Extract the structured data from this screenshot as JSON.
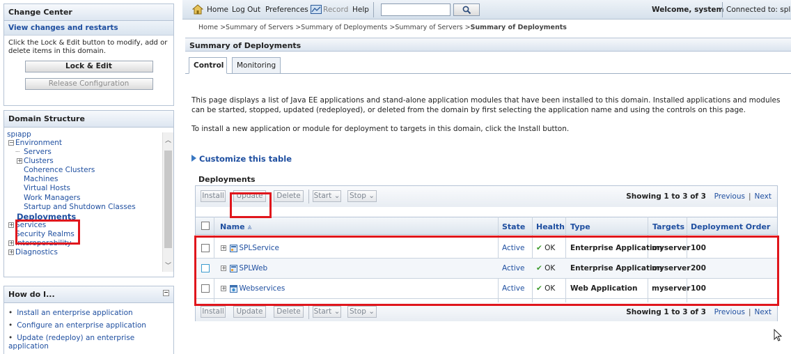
{
  "change_center": {
    "title": "Change Center",
    "view_changes": "View changes and restarts",
    "hint": "Click the Lock & Edit button to modify, add or delete items in this domain.",
    "lock_edit": "Lock & Edit",
    "release_config": "Release Configuration"
  },
  "domain_structure": {
    "title": "Domain Structure",
    "root": "splapp",
    "nodes": [
      "Environment",
      "Servers",
      "Clusters",
      "Coherence Clusters",
      "Machines",
      "Virtual Hosts",
      "Work Managers",
      "Startup and Shutdown Classes",
      "Deployments",
      "Services",
      "Security Realms",
      "Interoperability",
      "Diagnostics"
    ]
  },
  "how_do_i": {
    "title": "How do I...",
    "items": [
      "Install an enterprise application",
      "Configure an enterprise application",
      "Update (redeploy) an enterprise application"
    ]
  },
  "toolbar": {
    "home": "Home",
    "logout": "Log Out",
    "preferences": "Preferences",
    "record": "Record",
    "help": "Help",
    "search_value": "",
    "welcome_label": "Welcome, system",
    "connected_label": "Connected to: splap"
  },
  "breadcrumb": {
    "path": "Home >Summary of Servers >Summary of Deployments >Summary of Servers >",
    "current": "Summary of Deployments"
  },
  "page": {
    "title": "Summary of Deployments",
    "tabs": [
      "Control",
      "Monitoring"
    ],
    "desc1": "This page displays a list of Java EE applications and stand-alone application modules that have been installed to this domain. Installed applications and modules can be started, stopped, updated (redeployed), or deleted from the domain by first selecting the application name and using the controls on this page.",
    "desc2": "To install a new application or module for deployment to targets in this domain, click the Install button.",
    "customize": "Customize this table",
    "table_label": "Deployments"
  },
  "actions": {
    "install": "Install",
    "update": "Update",
    "delete": "Delete",
    "start": "Start",
    "stop": "Stop",
    "showing": "Showing 1 to 3 of 3",
    "previous": "Previous",
    "next": "Next"
  },
  "columns": [
    "Name",
    "State",
    "Health",
    "Type",
    "Targets",
    "Deployment Order"
  ],
  "rows": [
    {
      "name": "SPLService",
      "state": "Active",
      "health": "OK",
      "type": "Enterprise Application",
      "targets": "myserver",
      "order": "100"
    },
    {
      "name": "SPLWeb",
      "state": "Active",
      "health": "OK",
      "type": "Enterprise Application",
      "targets": "myserver",
      "order": "200"
    },
    {
      "name": "Webservices",
      "state": "Active",
      "health": "OK",
      "type": "Web Application",
      "targets": "myserver",
      "order": "100"
    }
  ],
  "colors": {
    "highlight": "#e0161c",
    "link": "#1f4fa0",
    "ok": "#3a9a2a"
  }
}
